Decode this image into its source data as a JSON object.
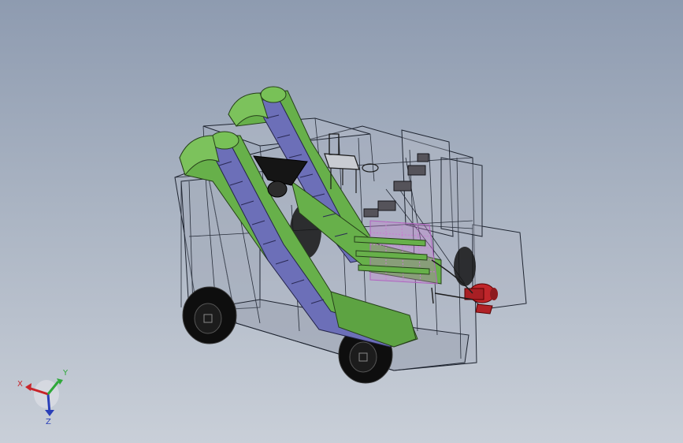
{
  "viewport": {
    "background_top": "#8e9bb0",
    "background_bottom": "#c9cfd8"
  },
  "model": {
    "colors": {
      "wireframe": "#1e2430",
      "glass": "#b3bac6",
      "conveyor_green": "#67b04a",
      "conveyor_belt_purple": "#6c6fb8",
      "rack_pink": "#c77fd0",
      "motor_red": "#c0262b",
      "hopper_black": "#151515",
      "wheel": "#101010"
    },
    "icons": [
      "conveyor-icon",
      "wheel-icon",
      "motor-icon",
      "seat-icon",
      "hopper-icon"
    ]
  },
  "triad": {
    "x_label": "X",
    "y_label": "Y",
    "z_label": "Z",
    "x_color": "#c8242a",
    "y_color": "#2fa83a",
    "z_color": "#2a3fb8"
  }
}
